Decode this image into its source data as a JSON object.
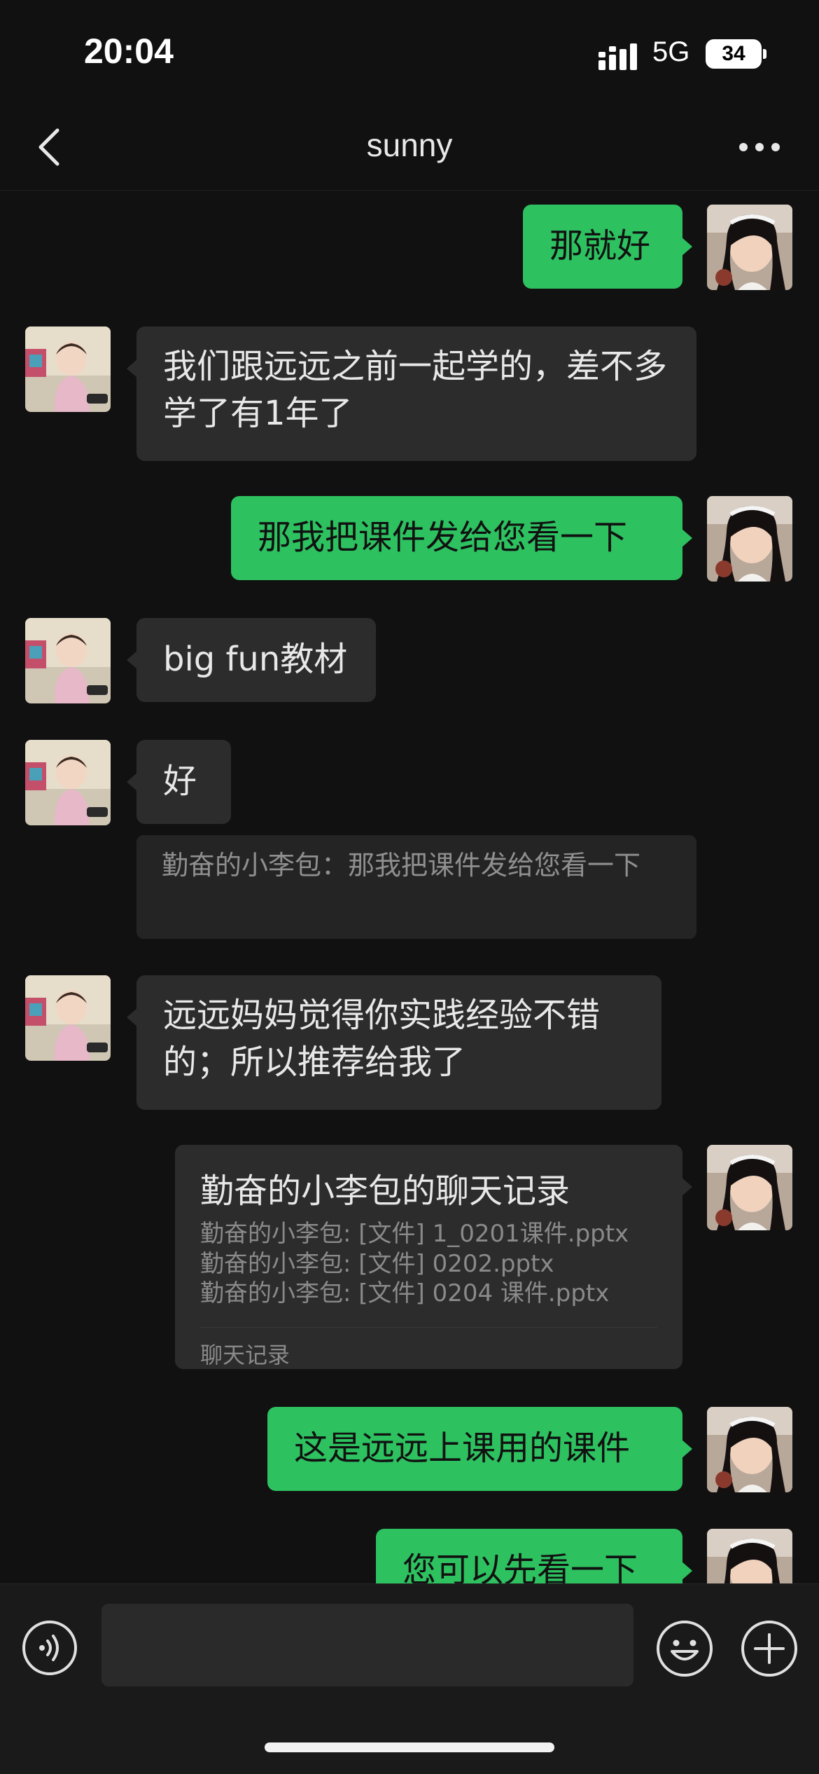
{
  "status_bar": {
    "time": "20:04",
    "network": "5G",
    "battery": "34",
    "icons": [
      "signal-icon",
      "battery-icon"
    ]
  },
  "header": {
    "title": "sunny",
    "back_icon": "chevron-left-icon",
    "more_icon": "more-dots-icon"
  },
  "colors": {
    "background": "#111111",
    "sent_bubble": "#2dc160",
    "received_bubble": "#2c2c2c",
    "muted_text": "#8a8a8a"
  },
  "messages": [
    {
      "direction": "sent",
      "text": "那就好"
    },
    {
      "direction": "received",
      "text": "我们跟远远之前一起学的，差不多学了有1年了"
    },
    {
      "direction": "sent",
      "text": "那我把课件发给您看一下"
    },
    {
      "direction": "received",
      "text": "big fun教材"
    },
    {
      "direction": "received",
      "text": "好",
      "quote": "勤奋的小李包：那我把课件发给您看一下"
    },
    {
      "direction": "received",
      "text": "远远妈妈觉得你实践经验不错的；所以推荐给我了"
    },
    {
      "direction": "sent",
      "type": "chat_record",
      "title": "勤奋的小李包的聊天记录",
      "lines": [
        "勤奋的小李包: [文件] 1_0201课件.pptx",
        "勤奋的小李包: [文件] 0202.pptx",
        "勤奋的小李包: [文件] 0204 课件.pptx"
      ],
      "footer": "聊天记录"
    },
    {
      "direction": "sent",
      "text": "这是远远上课用的课件"
    },
    {
      "direction": "sent",
      "text": "您可以先看一下"
    }
  ],
  "input_bar": {
    "voice_icon": "voice-icon",
    "input_value": "",
    "emoji_icon": "emoji-icon",
    "add_icon": "add-icon"
  }
}
